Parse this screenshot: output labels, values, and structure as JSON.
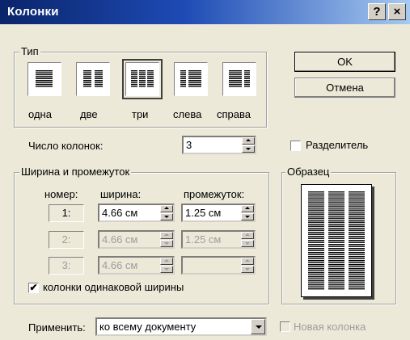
{
  "title": "Колонки",
  "titlebar": {
    "help": "?",
    "close": "×"
  },
  "type_group": {
    "legend": "Тип",
    "options": [
      {
        "label": "одна",
        "cols": 1,
        "selected": false
      },
      {
        "label": "две",
        "cols": 2,
        "selected": false
      },
      {
        "label": "три",
        "cols": 3,
        "selected": true
      },
      {
        "label": "слева",
        "cols": "left",
        "selected": false
      },
      {
        "label": "справа",
        "cols": "right",
        "selected": false
      }
    ]
  },
  "ok_label": "OK",
  "cancel_label": "Отмена",
  "num_columns": {
    "label": "Число колонок:",
    "value": "3"
  },
  "separator": {
    "label": "Разделитель",
    "checked": false
  },
  "width_group": {
    "legend": "Ширина и промежуток",
    "col_number": "номер:",
    "col_width": "ширина:",
    "col_spacing": "промежуток:",
    "rows": [
      {
        "num": "1:",
        "width": "4.66 см",
        "spacing": "1.25 см",
        "enabled": true
      },
      {
        "num": "2:",
        "width": "4.66 см",
        "spacing": "1.25 см",
        "enabled": false
      },
      {
        "num": "3:",
        "width": "4.66 см",
        "spacing": "",
        "enabled": false
      }
    ],
    "equal_width": {
      "label": "колонки одинаковой ширины",
      "checked": true
    }
  },
  "preview": {
    "legend": "Образец"
  },
  "apply": {
    "label": "Применить:",
    "value": "ко всему документу"
  },
  "new_column": {
    "label": "Новая колонка",
    "checked": false,
    "enabled": false
  }
}
